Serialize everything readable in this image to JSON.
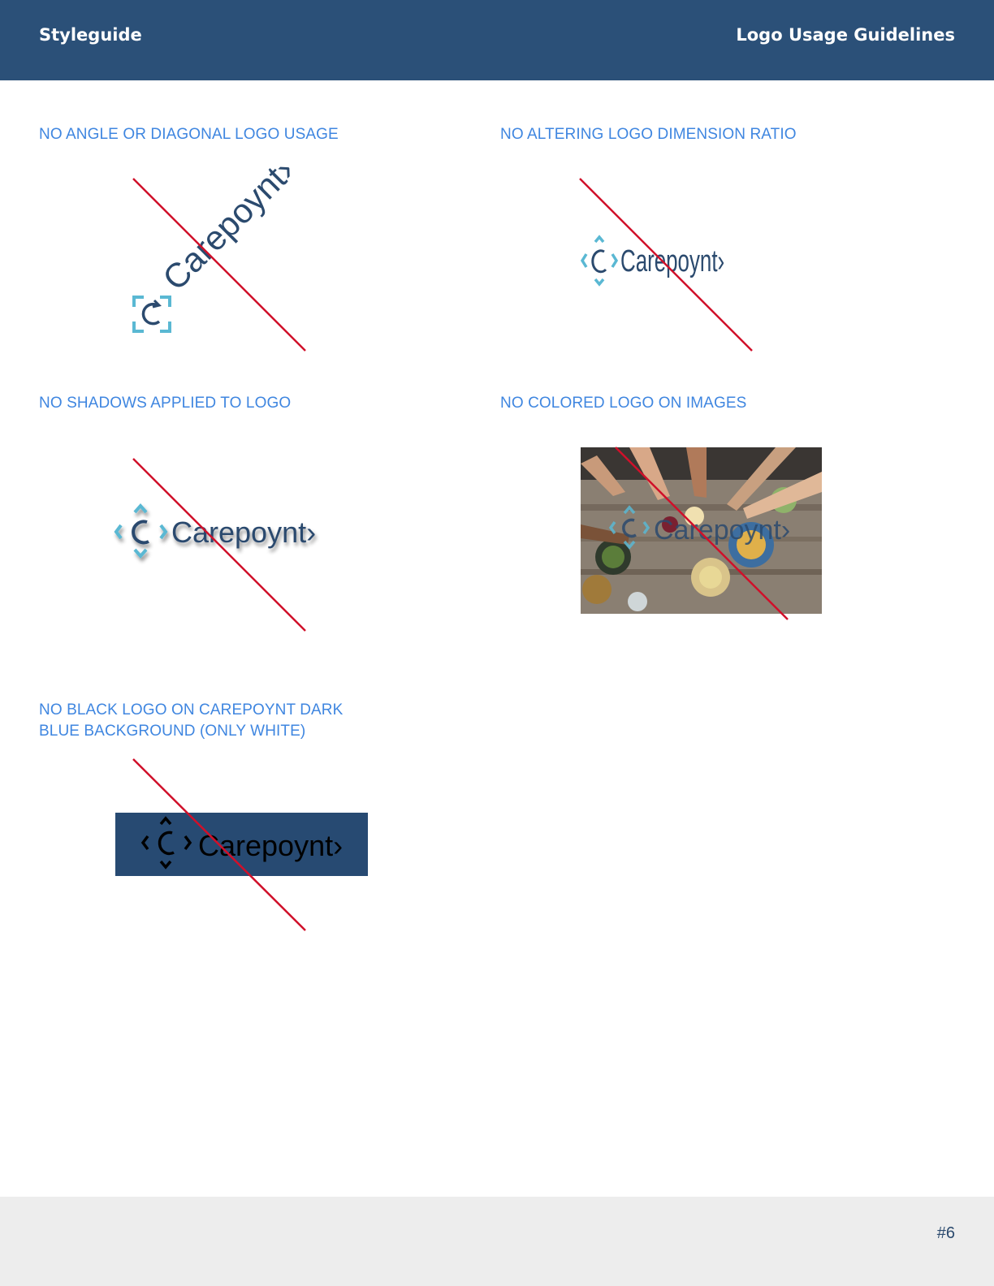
{
  "header": {
    "left_title": "Styleguide",
    "right_title": "Logo Usage Guidelines"
  },
  "rules": [
    {
      "title": "NO ANGLE OR DIAGONAL LOGO USAGE"
    },
    {
      "title": "NO ALTERING LOGO DIMENSION RATIO"
    },
    {
      "title": "NO SHADOWS APPLIED TO LOGO"
    },
    {
      "title": "NO COLORED LOGO ON IMAGES"
    },
    {
      "title_line1": "NO BLACK LOGO ON CAREPOYNT DARK",
      "title_line2": "BLUE BACKGROUND (ONLY WHITE)"
    }
  ],
  "logo": {
    "wordmark": "Carepoynt›"
  },
  "colors": {
    "header_bg": "#2b5078",
    "title_blue": "#3f86e0",
    "strike_red": "#d0102a",
    "logo_navy": "#2b4a6e",
    "logo_cyan": "#5ab8d3",
    "dark_blue_bg": "#274a72",
    "footer_bg": "#ededed"
  },
  "footer": {
    "page_number": "#6"
  }
}
